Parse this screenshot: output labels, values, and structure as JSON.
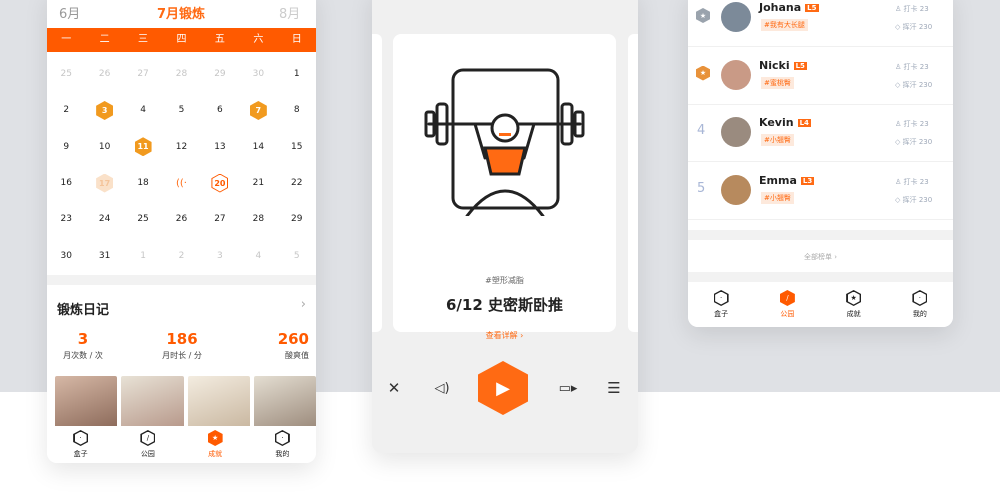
{
  "colors": {
    "accent": "#ff5a00",
    "badge": "#f19a1f",
    "rank_blue": "#a8b6d6"
  },
  "calendar": {
    "prev_month": "6月",
    "current_month": "7月锻炼",
    "next_month": "8月",
    "weekdays": [
      "一",
      "二",
      "三",
      "四",
      "五",
      "六",
      "日"
    ],
    "days": [
      {
        "t": "25",
        "k": "dim"
      },
      {
        "t": "26",
        "k": "dim"
      },
      {
        "t": "27",
        "k": "dim"
      },
      {
        "t": "28",
        "k": "dim"
      },
      {
        "t": "29",
        "k": "dim"
      },
      {
        "t": "30",
        "k": "dim"
      },
      {
        "t": "1",
        "k": "n"
      },
      {
        "t": "2",
        "k": "n"
      },
      {
        "t": "3",
        "k": "badge"
      },
      {
        "t": "4",
        "k": "n"
      },
      {
        "t": "5",
        "k": "n"
      },
      {
        "t": "6",
        "k": "n"
      },
      {
        "t": "7",
        "k": "badge"
      },
      {
        "t": "8",
        "k": "n"
      },
      {
        "t": "9",
        "k": "n"
      },
      {
        "t": "10",
        "k": "n"
      },
      {
        "t": "11",
        "k": "badge"
      },
      {
        "t": "12",
        "k": "n"
      },
      {
        "t": "13",
        "k": "n"
      },
      {
        "t": "14",
        "k": "n"
      },
      {
        "t": "15",
        "k": "n"
      },
      {
        "t": "16",
        "k": "n"
      },
      {
        "t": "17",
        "k": "pale"
      },
      {
        "t": "18",
        "k": "n"
      },
      {
        "t": "",
        "k": "wifi"
      },
      {
        "t": "20",
        "k": "ring"
      },
      {
        "t": "21",
        "k": "n"
      },
      {
        "t": "22",
        "k": "n"
      },
      {
        "t": "23",
        "k": "n"
      },
      {
        "t": "24",
        "k": "n"
      },
      {
        "t": "25",
        "k": "n"
      },
      {
        "t": "26",
        "k": "n"
      },
      {
        "t": "27",
        "k": "n"
      },
      {
        "t": "28",
        "k": "n"
      },
      {
        "t": "29",
        "k": "n"
      },
      {
        "t": "30",
        "k": "n"
      },
      {
        "t": "31",
        "k": "n"
      },
      {
        "t": "1",
        "k": "dim"
      },
      {
        "t": "2",
        "k": "dim"
      },
      {
        "t": "3",
        "k": "dim"
      },
      {
        "t": "4",
        "k": "dim"
      },
      {
        "t": "5",
        "k": "dim"
      }
    ]
  },
  "diary": {
    "title": "锻炼日记",
    "stats": [
      {
        "value": "3",
        "label": "月次数 / 次"
      },
      {
        "value": "186",
        "label": "月时长 / 分"
      },
      {
        "value": "260",
        "label": "酸爽值"
      }
    ]
  },
  "tabs": [
    {
      "label": "盒子",
      "icon": "box-icon",
      "glyph": "·"
    },
    {
      "label": "公园",
      "icon": "park-icon",
      "glyph": "/"
    },
    {
      "label": "成就",
      "icon": "star-icon",
      "glyph": "★"
    },
    {
      "label": "我的",
      "icon": "face-icon",
      "glyph": "·"
    }
  ],
  "workout": {
    "tag": "#塑形减脂",
    "title": "6/12 史密斯卧推",
    "more": "查看详解 ›"
  },
  "ranking": {
    "rows": [
      {
        "rank": "",
        "medal": "silver",
        "name": "Johana",
        "level": "L5",
        "tag": "#我有大长腿",
        "checkin": "打卡 23",
        "sweat": "挥汗 230",
        "avatar": "#7c8a99"
      },
      {
        "rank": "",
        "medal": "bronze",
        "name": "Nicki",
        "level": "L5",
        "tag": "#蜜桃臀",
        "checkin": "打卡 23",
        "sweat": "挥汗 230",
        "avatar": "#c99a86"
      },
      {
        "rank": "4",
        "medal": "",
        "name": "Kevin",
        "level": "L4",
        "tag": "#小翘臀",
        "checkin": "打卡 23",
        "sweat": "挥汗 230",
        "avatar": "#9a8b7f"
      },
      {
        "rank": "5",
        "medal": "",
        "name": "Emma",
        "level": "L3",
        "tag": "#小翘臀",
        "checkin": "打卡 23",
        "sweat": "挥汗 230",
        "avatar": "#b78a5e"
      }
    ],
    "all_label": "全部榜单 ›"
  }
}
